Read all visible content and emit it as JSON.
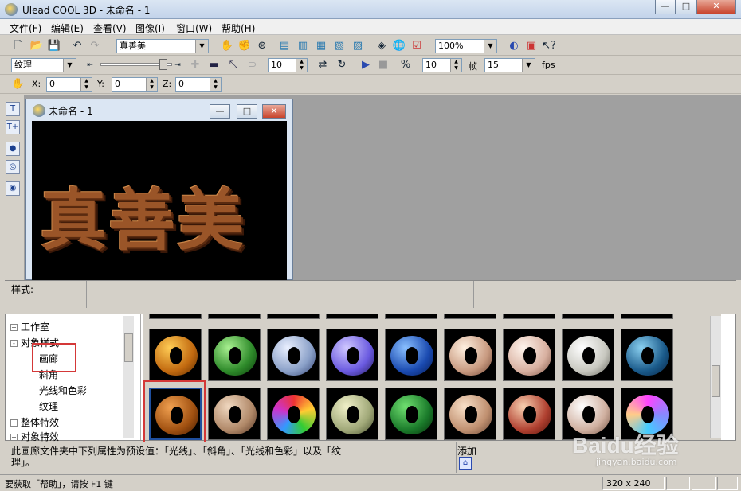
{
  "window": {
    "title": "Ulead COOL 3D - 未命名 - 1"
  },
  "menu": [
    "文件(F)",
    "编辑(E)",
    "查看(V)",
    "图像(I)",
    "窗口(W)",
    "帮助(H)"
  ],
  "toolbar1": {
    "font_value": "真善美",
    "zoom_value": "100%"
  },
  "toolbar2": {
    "mode_value": "纹理",
    "frame_value": "10",
    "frame2_value": "10",
    "frame_label": "帧",
    "fps_value": "15",
    "fps_label": "fps"
  },
  "toolbar3": {
    "x_label": "X:",
    "x_value": "0",
    "y_label": "Y:",
    "y_value": "0",
    "z_label": "Z:",
    "z_value": "0"
  },
  "document": {
    "title": "未命名 - 1",
    "text": "真善美"
  },
  "stylebar": {
    "label": "样式:"
  },
  "tree": [
    {
      "label": "工作室",
      "toggle": "+"
    },
    {
      "label": "对象样式",
      "toggle": "-"
    },
    {
      "label": "画廊"
    },
    {
      "label": "斜角"
    },
    {
      "label": "光线和色彩"
    },
    {
      "label": "纹理"
    },
    {
      "label": "整体特效",
      "toggle": "+"
    },
    {
      "label": "对象特效",
      "toggle": "+"
    }
  ],
  "description": {
    "text_line1": "此画廊文件夹中下列属性为预设值：「光线」、「斜角」、「光线和色彩」以及「纹",
    "text_line2": "理」。",
    "add_label": "添加"
  },
  "status": {
    "help_text": "要获取「帮助」，请按 F1 键",
    "size_text": "320 x 240"
  },
  "watermark": {
    "brand": "Baidu经验",
    "url": "jingyan.baidu.com"
  },
  "colors": {
    "highlight": "#d43838",
    "selection": "#1e4e9e"
  }
}
